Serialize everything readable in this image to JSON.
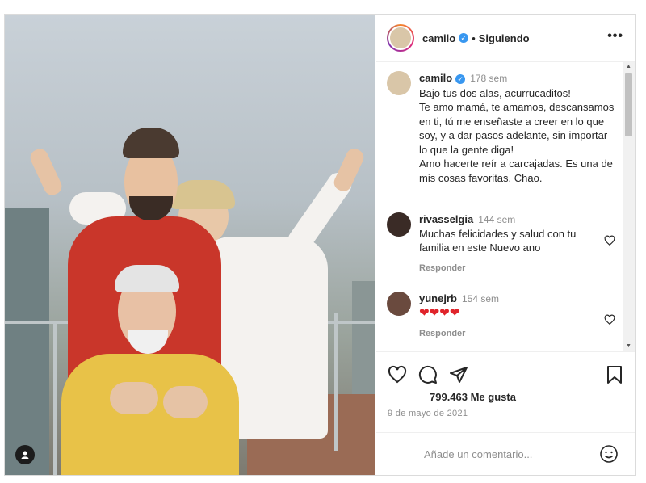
{
  "header": {
    "username": "camilo",
    "separator": "•",
    "follow_status": "Siguiendo",
    "more_icon": "ellipsis-icon"
  },
  "caption": {
    "username": "camilo",
    "time": "178 sem",
    "text": "Bajo tus dos alas, acurrucaditos!\nTe amo mamá, te amamos, descansamos en ti, tú me enseñaste a creer en lo que soy, y a dar pasos adelante, sin importar lo que la gente diga!\nAmo hacerte reír a carcajadas. Es una de mis cosas favoritas. Chao."
  },
  "comments": [
    {
      "username": "rivasselgia",
      "time": "144 sem",
      "text": "Muchas felicidades y salud con tu familia en este Nuevo ano",
      "reply": "Responder"
    },
    {
      "username": "yunejrb",
      "time": "154 sem",
      "text": "❤❤❤❤",
      "reply": "Responder"
    }
  ],
  "actions": {
    "likes": "799.463 Me gusta",
    "date": "9 de mayo de 2021"
  },
  "add_comment": {
    "placeholder": "Añade un comentario..."
  },
  "colors": {
    "verified": "#3897f0",
    "heart": "#e0242b"
  }
}
